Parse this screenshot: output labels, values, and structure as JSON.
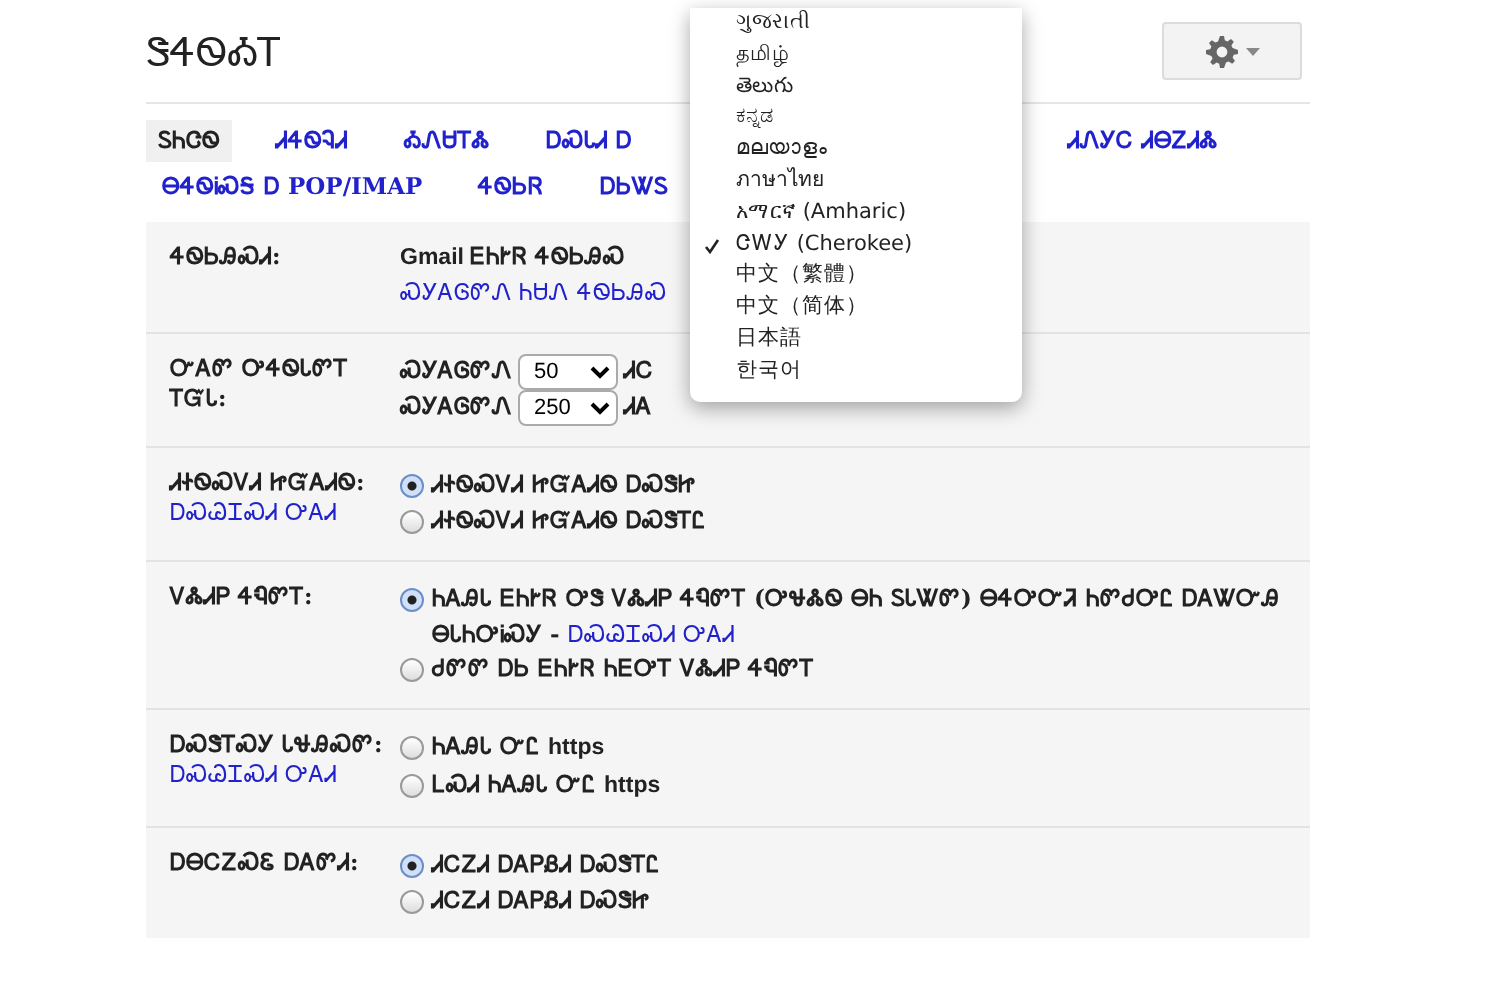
{
  "title": "ᏕᏎᏫᎣᎢ",
  "tab_rows": [
    [
      {
        "label": "ᏚᏂᏣᏫ",
        "selected": true
      },
      {
        "label": "ᏗᏎᏫᎸᏗ",
        "selected": false
      },
      {
        "label": "ᎣᏁᏌᎢᏜ",
        "selected": false
      },
      {
        "label": "ᎠᏍᏓᏗ Ꭰ",
        "selected": false
      },
      {
        "label": "ᏗᏁᎩᏟ ᏗᎾᏃᏗᏜ",
        "selected": false
      }
    ],
    [
      {
        "label": "ᎾᏎᏫᎥᏍᎦ Ꭰ POP/IMAP",
        "selected": false
      },
      {
        "label": "ᏎᏫᏏᏒ",
        "selected": false
      },
      {
        "label": "ᎠᏏᏔᏚ",
        "selected": false
      }
    ]
  ],
  "settings": [
    {
      "label": "ᏎᏫᏏᎯᏍᏗ:",
      "options": [
        {
          "kind": "text",
          "text": "Gmail ᎬᏂᎨᏒ ᏎᏫᏏᎯᏍ"
        },
        {
          "kind": "link",
          "text": "ᏍᎩᎪᎶᏛᏁ ᏂᏌᏁ ᏎᏫᏏᎯᏍ"
        }
      ]
    },
    {
      "label": "ᏅᎪᏛ ᎤᏎᏫᏓᏛᎢ ᎢᏳᏓ:",
      "options": [
        {
          "kind": "select",
          "prefix": "ᏍᎩᎪᎶᏛᏁ",
          "value": "50",
          "suffix": "ᏗᏟ"
        },
        {
          "kind": "select",
          "prefix": "ᏍᎩᎪᎶᏛᏁ",
          "value": "250",
          "suffix": "ᏗᎪ"
        }
      ]
    },
    {
      "label": "ᏗᏐᏫᏍᏙᏗ ᏥᏳᎪᏗᏫ:",
      "link": "ᎠᏍᏊᏆᏍᏗ ᎤᎪᏗ",
      "options": [
        {
          "kind": "radio",
          "text": "ᏗᏐᏫᏍᏙᏗ ᏥᏳᎪᏗᏫ ᎠᏍᏕᏥ",
          "selected": true
        },
        {
          "kind": "radio",
          "text": "ᏗᏐᏫᏍᏙᏗ ᏥᏳᎪᏗᏫ ᎠᏍᏕᎢᏝ",
          "selected": false
        }
      ]
    },
    {
      "label": "ᏙᏜᏗᏢ ᏎᏄᏛᎢ:",
      "options": [
        {
          "kind": "radio",
          "text": "ᏂᎪᎯᏓ ᎬᏂᎨᏒ ᎤᏕ ᏙᏜᏗᏢ ᏎᏄᏛᎢ (ᎤᏠᏜᏫ ᎾᏂ ᏚᏓᏔᏛ) ᎾᏎᎤᏅᏘ ᏂᏛᏧᎤᏝ ᎠᎪᏔᏅᎯ ᎾᏓᏂᎤᎥᏍᎩ -",
          "link": "ᎠᏍᏊᏆᏍᏗ ᎤᎪᏗ",
          "selected": true
        },
        {
          "kind": "radio",
          "text": "ᏧᏛᏛ ᎠᏏ ᎬᏂᎨᏒ ᏂᎬᎤᎢ ᏙᏜᏗᏢ ᏎᏄᏛᎢ",
          "selected": false
        }
      ]
    },
    {
      "label": "ᎠᏍᏕᎢᏍᎩ ᏓᏠᎯᏍᏛ:",
      "link": "ᎠᏍᏊᏆᏍᏗ ᎤᎪᏗ",
      "options": [
        {
          "kind": "radio",
          "text": "ᏂᎪᎯᏓ ᏅᏝ https",
          "selected": false
        },
        {
          "kind": "radio",
          "text": "ᏞᏍᏗ ᏂᎪᎯᏓ ᏅᏝ https",
          "selected": false
        }
      ]
    },
    {
      "label": "ᎠᎾᏟᏃᏍᏋ ᎠᎪᏛᏗ:",
      "options": [
        {
          "kind": "radio",
          "text": "ᏗᏟᏃᏗ ᎠᎪᏢᏰᏗ ᎠᏍᏕᎢᏝ",
          "selected": true
        },
        {
          "kind": "radio",
          "text": "ᏗᏟᏃᏗ ᎠᎪᏢᏰᏗ ᎠᏍᏕᏥ",
          "selected": false
        }
      ]
    }
  ],
  "language_menu": {
    "items": [
      {
        "label": "ગુજરાતી",
        "checked": false
      },
      {
        "label": "தமிழ்",
        "checked": false
      },
      {
        "label": "తెలుగు",
        "checked": false
      },
      {
        "label": "ಕನ್ನಡ",
        "checked": false
      },
      {
        "label": "മലയാളം",
        "checked": false
      },
      {
        "label": "ภาษาไทย",
        "checked": false
      },
      {
        "label": "አማርኛ (Amharic)",
        "checked": false
      },
      {
        "label": "ᏣᎳᎩ (Cherokee)",
        "checked": true
      },
      {
        "label": "中文（繁體）",
        "checked": false
      },
      {
        "label": "中文（简体）",
        "checked": false
      },
      {
        "label": "日本語",
        "checked": false
      },
      {
        "label": "한국어",
        "checked": false
      }
    ]
  }
}
